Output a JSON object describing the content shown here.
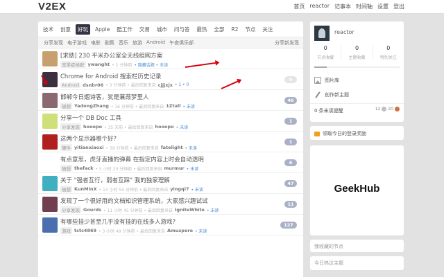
{
  "topbar": {
    "logo": "V2EX",
    "nav": [
      "首页",
      "reactor",
      "记事本",
      "时间轴",
      "设置",
      "登出"
    ]
  },
  "tabs": [
    "技术",
    "创意",
    "好玩",
    "Apple",
    "酷工作",
    "交易",
    "城市",
    "问与答",
    "最热",
    "全部",
    "R2",
    "节点",
    "关注"
  ],
  "subtabs": [
    "分享发现",
    "电子游戏",
    "电影",
    "剧集",
    "音乐",
    "旅游",
    "Android",
    "午夜俱乐部"
  ],
  "subtab_right": "分享新发现",
  "topics": [
    {
      "title": "[求助] 230 平米办公室全无线组网方案",
      "node": "宽带症候群",
      "author": "ywanght",
      "time": "• 2 分钟前",
      "last_prefix": "",
      "last_user": "",
      "extra": "• 隐藏话题 • 未读",
      "count": "",
      "avatar": "#c8a070"
    },
    {
      "title": "Chrome for Android 搜索栏历史记录",
      "node": "Android",
      "author": "dsnbr06",
      "time": "• 3 分钟前 • 最后回复来自",
      "last_prefix": "",
      "last_user": "cjjjxjx",
      "extra": "• 1 • 0",
      "count": "0",
      "avatar": "#3a3040"
    },
    {
      "title": "邯郸今日烟诗客，犹是蒹葭梦里人",
      "node": "随想",
      "author": "YadongZhang",
      "time": "• 16 分钟前 • 最后回复来自",
      "last_prefix": "",
      "last_user": "1Ztall",
      "extra": "• 未读",
      "count": "46",
      "avatar": "#8a6a70"
    },
    {
      "title": "分享一个 DB Doc 工具",
      "node": "分享发现",
      "author": "hooopo",
      "time": "• 35 天前 • 最后回复来自",
      "last_prefix": "",
      "last_user": "hooopo",
      "extra": "• 未读",
      "count": "1",
      "avatar": "#cfe07a"
    },
    {
      "title": "这两个显示器哪个好?",
      "node": "硬件",
      "author": "yitianxiaoxi",
      "time": "• 39 分钟前 • 最后回复来自",
      "last_prefix": "",
      "last_user": "fatelight",
      "extra": "• 未读",
      "count": "1",
      "avatar": "#b02020"
    },
    {
      "title": "有点意思，虎牙直播的弹幕 在指定内容上时会自动透明",
      "node": "随想",
      "author": "thefack",
      "time": "• 5 小时 20 分钟前 • 最后回复来自",
      "last_prefix": "",
      "last_user": "murmur",
      "extra": "• 未读",
      "count": "6",
      "avatar": "#ffffff"
    },
    {
      "title": "关于 \"强者互行，弱者互踩\" 我的独家理解",
      "node": "随想",
      "author": "KunMinX",
      "time": "• 14 小时 55 分钟前 • 最后回复来自",
      "last_prefix": "",
      "last_user": "yingqi7",
      "extra": "• 未读",
      "count": "47",
      "avatar": "#40b0c0"
    },
    {
      "title": "发现了一个很好用的文档知识管理系统，大家感兴趣试试",
      "node": "分享发现",
      "author": "Gourds",
      "time": "• 11 小时 45 分钟前 • 最后回复来自",
      "last_prefix": "",
      "last_user": "IgniteWhite",
      "extra": "• 未读",
      "count": "11",
      "avatar": "#704050"
    },
    {
      "title": "有哪些挂少甚至几乎没有挂的在线多人游戏?",
      "node": "游戏",
      "author": "tctc4869",
      "time": "• 3 小时 49 分钟前 • 最后回复来自",
      "last_prefix": "",
      "last_user": "Amuspere",
      "extra": "• 未读",
      "count": "127",
      "avatar": "#4a6fb0"
    }
  ],
  "side": {
    "username": "reactor",
    "stats": [
      {
        "n": "0",
        "l": "节点收藏"
      },
      {
        "n": "0",
        "l": "主题收藏"
      },
      {
        "n": "0",
        "l": "特别关注"
      }
    ],
    "images_label": "图片库",
    "create_label": "创作新主题",
    "unread_label": "0 条未读提醒",
    "coins_silver": "12",
    "coins_bronze": "20",
    "mission_label": "领取今日的登录奖励",
    "ad_text": "GeekHub",
    "nodes_label": "我收藏的节点",
    "hot_label": "今日热议主题"
  },
  "colors": {
    "active_tab": "#334455",
    "count_badge": "#aab0c6",
    "link_blue": "#4a8cd3",
    "annotation_red": "#d8000c"
  }
}
